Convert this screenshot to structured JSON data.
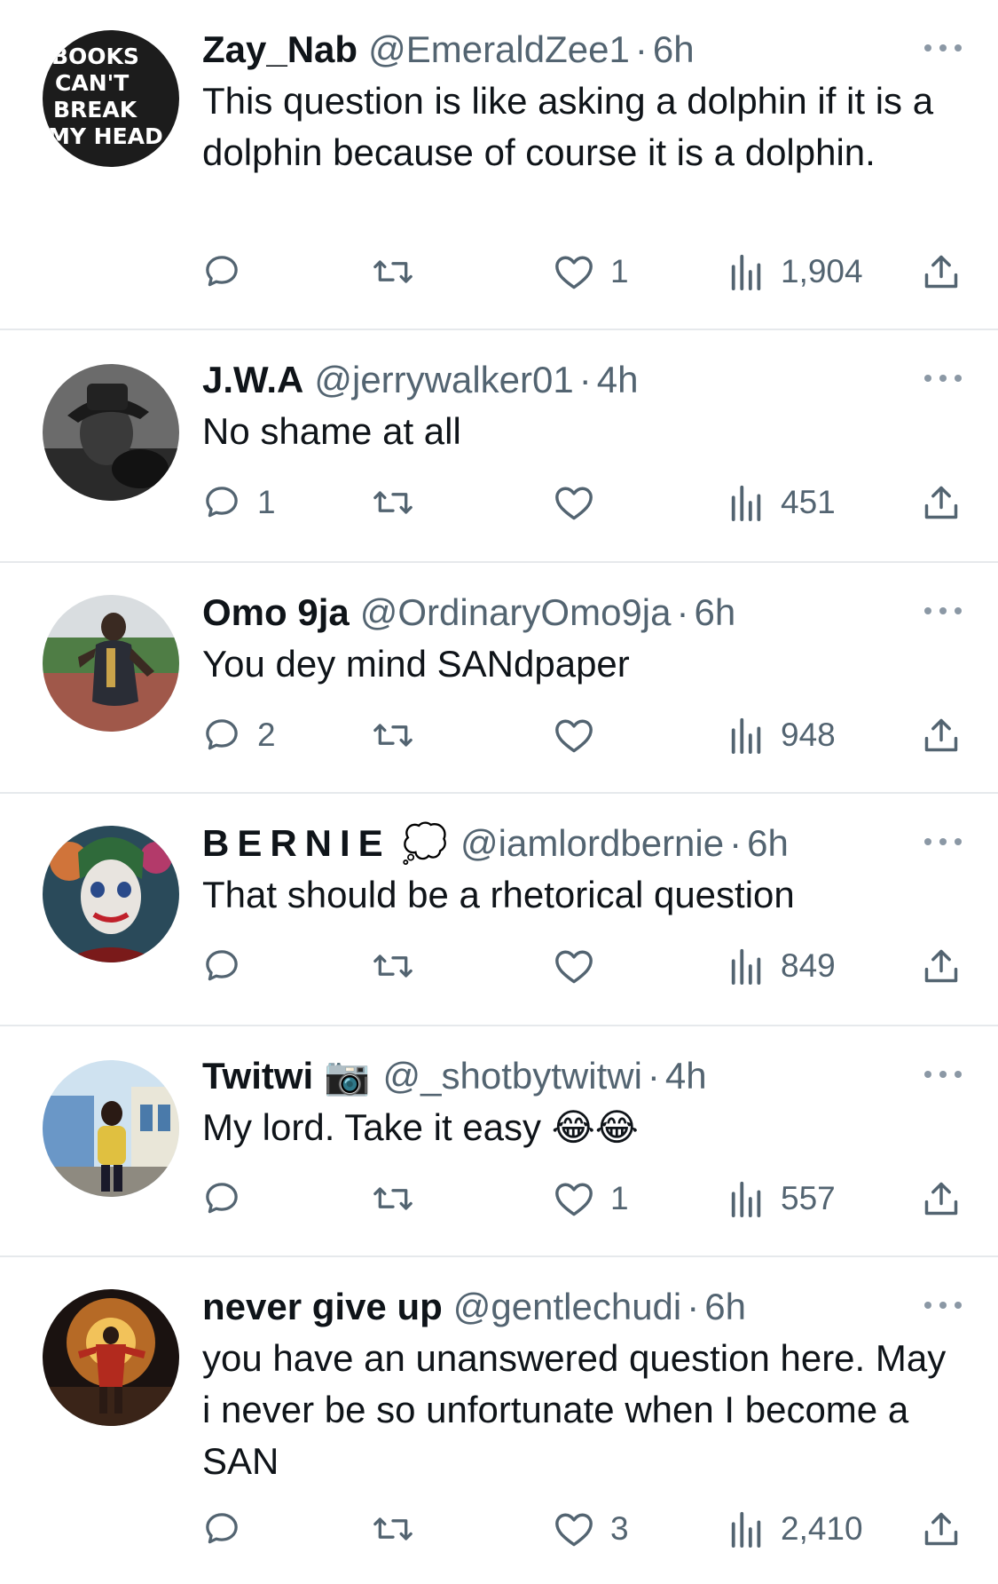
{
  "colors": {
    "text": "#0f1419",
    "secondary": "#536471",
    "divider": "#e6e9ec"
  },
  "tweets": [
    {
      "name": "Zay_Nab",
      "handle": "@EmeraldZee1",
      "separator": "·",
      "time": "6h",
      "text": "This question is like asking a dolphin if it is a dolphin because of course it is a dolphin.",
      "avatar_text": [
        "BOOKS",
        "CAN'T",
        "BREAK",
        "MY HEAD"
      ],
      "replies": "",
      "likes": "1",
      "views": "1,904"
    },
    {
      "name": "J.W.A",
      "handle": "@jerrywalker01",
      "separator": "·",
      "time": "4h",
      "text": "No shame at all",
      "replies": "1",
      "likes": "",
      "views": "451"
    },
    {
      "name": "Omo 9ja",
      "handle": "@OrdinaryOmo9ja",
      "separator": "·",
      "time": "6h",
      "text": "You dey mind SANdpaper",
      "replies": "2",
      "likes": "",
      "views": "948"
    },
    {
      "name": "BERNIE",
      "name_emoji": "💭",
      "handle": "@iamlordbernie",
      "separator": "·",
      "time": "6h",
      "text": "That should be a rhetorical question",
      "replies": "",
      "likes": "",
      "views": "849"
    },
    {
      "name": "Twitwi",
      "name_emoji": "📷",
      "handle": "@_shotbytwitwi",
      "separator": "·",
      "time": "4h",
      "text": "My lord. Take it easy 😂😂",
      "replies": "",
      "likes": "1",
      "views": "557"
    },
    {
      "name": "never give up",
      "handle": "@gentlechudi",
      "separator": "·",
      "time": "6h",
      "text": "you have an unanswered question here. May i never be so unfortunate when I become a SAN",
      "replies": "",
      "likes": "3",
      "views": "2,410"
    }
  ],
  "icons": {
    "more": "more-horizontal-icon",
    "reply": "reply-bubble-icon",
    "retweet": "retweet-icon",
    "like": "heart-icon",
    "views": "bar-chart-views-icon",
    "share": "share-upload-icon"
  }
}
